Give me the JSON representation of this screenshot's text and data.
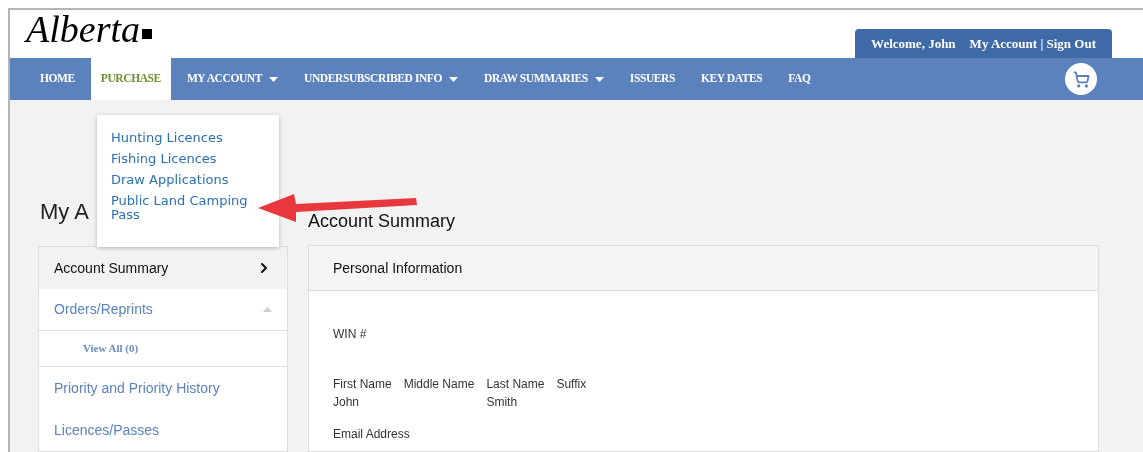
{
  "header": {
    "logo": "Alberta",
    "welcome": "Welcome, John",
    "account_links": "My Account | Sign Out"
  },
  "nav": [
    {
      "label": "HOME",
      "selected": false,
      "caret": false
    },
    {
      "label": "PURCHASE",
      "selected": true,
      "caret": false
    },
    {
      "label": "MY ACCOUNT",
      "selected": false,
      "caret": true
    },
    {
      "label": "UNDERSUBSCRIBED INFO",
      "selected": false,
      "caret": true
    },
    {
      "label": "DRAW SUMMARIES",
      "selected": false,
      "caret": true
    },
    {
      "label": "ISSUERS",
      "selected": false,
      "caret": false
    },
    {
      "label": "KEY DATES",
      "selected": false,
      "caret": false
    },
    {
      "label": "FAQ",
      "selected": false,
      "caret": false
    }
  ],
  "dropdown": [
    "Hunting Licences",
    "Fishing Licences",
    "Draw Applications",
    "Public Land Camping Pass"
  ],
  "page_title": "My A",
  "sidebar": [
    {
      "kind": "item",
      "label": "Account Summary",
      "selected": true
    },
    {
      "kind": "group",
      "label": "Orders/Reprints",
      "selected": false,
      "expanded": true
    },
    {
      "kind": "sub",
      "label": "View All (0)",
      "selected": false
    },
    {
      "kind": "item",
      "label": "Priority and Priority History",
      "selected": false
    },
    {
      "kind": "item",
      "label": "Licences/Passes",
      "selected": false
    }
  ],
  "main": {
    "title": "Account Summary",
    "panel_title": "Personal Information",
    "win_label": "WIN #",
    "name_fields": [
      {
        "label": "First Name",
        "value": "John"
      },
      {
        "label": "Middle Name"
      },
      {
        "label": "Last Name",
        "value": "Smith"
      },
      {
        "label": "Suffix"
      }
    ],
    "email_label": "Email Address"
  }
}
